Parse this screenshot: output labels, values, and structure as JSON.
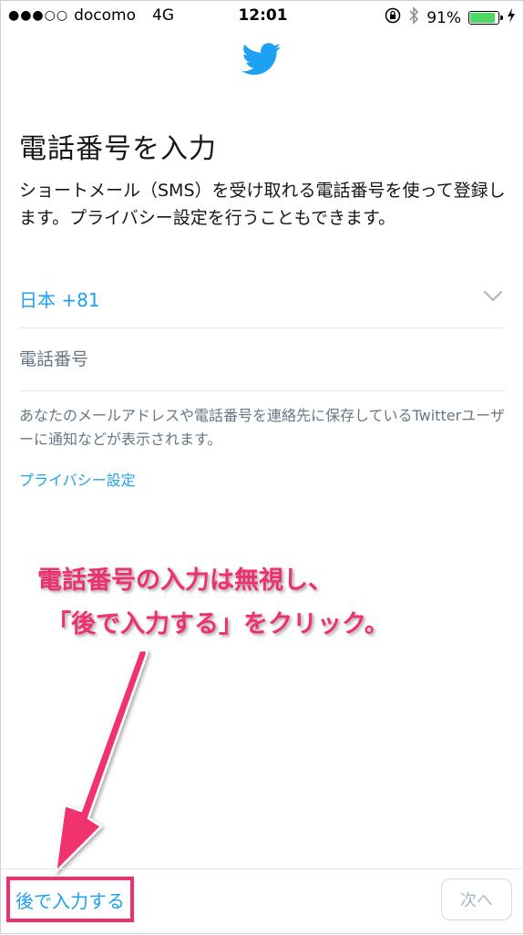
{
  "status_bar": {
    "signal": "●●●○○",
    "carrier": "docomo",
    "network": "4G",
    "time": "12:01",
    "battery_percent": "91%",
    "battery_level": 0.91,
    "battery_color": "#4cd964"
  },
  "icons": {
    "logo": "twitter-bird-icon",
    "lock": "orientation-lock-icon",
    "bluetooth": "bluetooth-icon",
    "charging": "charging-bolt-icon",
    "chevron": "chevron-down-icon"
  },
  "main": {
    "title": "電話番号を入力",
    "description": "ショートメール（SMS）を受け取れる電話番号を使って登録します。プライバシー設定を行うこともできます。",
    "country_selector": "日本 +81",
    "phone_placeholder": "電話番号",
    "note": "あなたのメールアドレスや電話番号を連絡先に保存しているTwitterユーザーに通知などが表示されます。",
    "privacy_link": "プライバシー設定"
  },
  "annotation": {
    "line1": "電話番号の入力は無視し、",
    "line2": "「後で入力する」をクリック。",
    "color": "#f0306e"
  },
  "bottom_bar": {
    "later_label": "後で入力する",
    "next_label": "次へ"
  },
  "colors": {
    "accent": "#1da1f2",
    "text": "#14171a",
    "muted": "#657786"
  }
}
